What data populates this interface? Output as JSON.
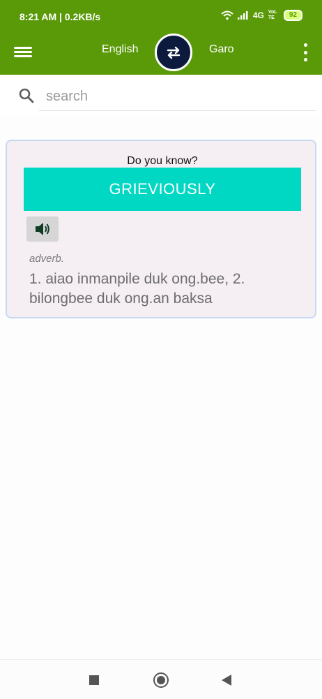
{
  "status": {
    "time": "8:21 AM | 0.2KB/s",
    "network": "4G",
    "volte": "VoLTE",
    "battery": "92"
  },
  "toolbar": {
    "source_lang": "English",
    "target_lang": "Garo"
  },
  "search": {
    "placeholder": "search",
    "value": ""
  },
  "card": {
    "title": "Do you know?",
    "word": "GRIEVIOUSLY",
    "part_of_speech": "adverb.",
    "meaning": "1. aiao inmanpile duk ong.bee, 2. bilongbee duk ong.an baksa"
  },
  "colors": {
    "appbar": "#5a9a09",
    "word_bar": "#00d8c4",
    "swap_button": "#0c1a3d"
  },
  "icons": [
    "menu-icon",
    "swap-icon",
    "more-vert-icon",
    "search-icon",
    "speaker-icon",
    "wifi-icon",
    "signal-icon"
  ]
}
